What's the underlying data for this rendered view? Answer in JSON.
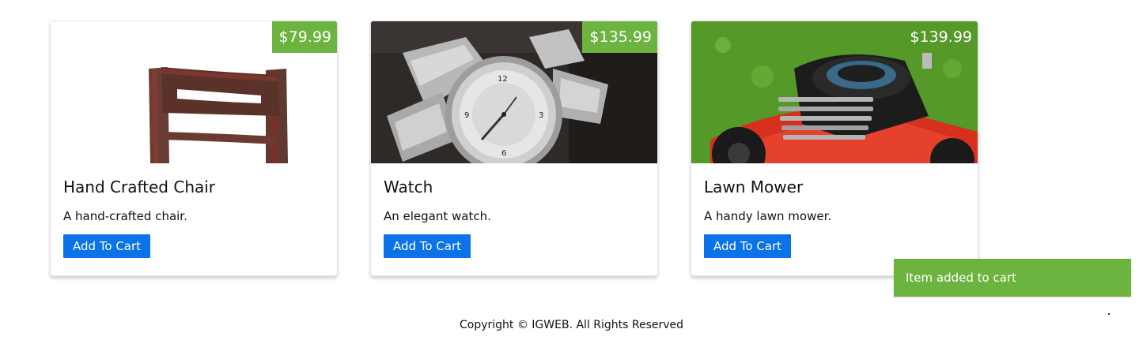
{
  "products": [
    {
      "name": "Hand Crafted Chair",
      "description": "A hand-crafted chair.",
      "price": "$79.99",
      "button_label": "Add To Cart",
      "image": "chair-image"
    },
    {
      "name": "Watch",
      "description": "An elegant watch.",
      "price": "$135.99",
      "button_label": "Add To Cart",
      "image": "watch-image"
    },
    {
      "name": "Lawn Mower",
      "description": "A handy lawn mower.",
      "price": "$139.99",
      "button_label": "Add To Cart",
      "image": "lawn-mower-image"
    }
  ],
  "toast": {
    "message": "Item added to cart"
  },
  "footer": {
    "copyright": "Copyright © IGWEB. All Rights Reserved"
  },
  "colors": {
    "price_tag": "#6db33f",
    "button": "#0b72e7",
    "toast": "#6db33f"
  }
}
